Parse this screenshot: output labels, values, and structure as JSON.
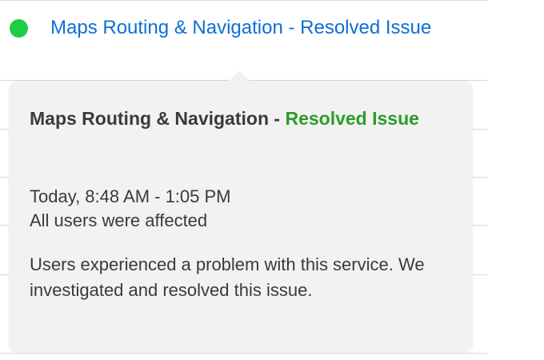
{
  "status": {
    "color": "#1fcc44",
    "service_link_text": "Maps Routing & Navigation - Resolved Issue",
    "link_color": "#0f6ed3"
  },
  "popover": {
    "title_service": "Maps Routing & Navigation - ",
    "title_status": "Resolved Issue",
    "status_color": "#2a9d2a",
    "time_range": "Today, 8:48 AM - 1:05 PM",
    "affected": "All users were affected",
    "description": "Users experienced a problem with this service. We investigated and resolved this issue."
  }
}
